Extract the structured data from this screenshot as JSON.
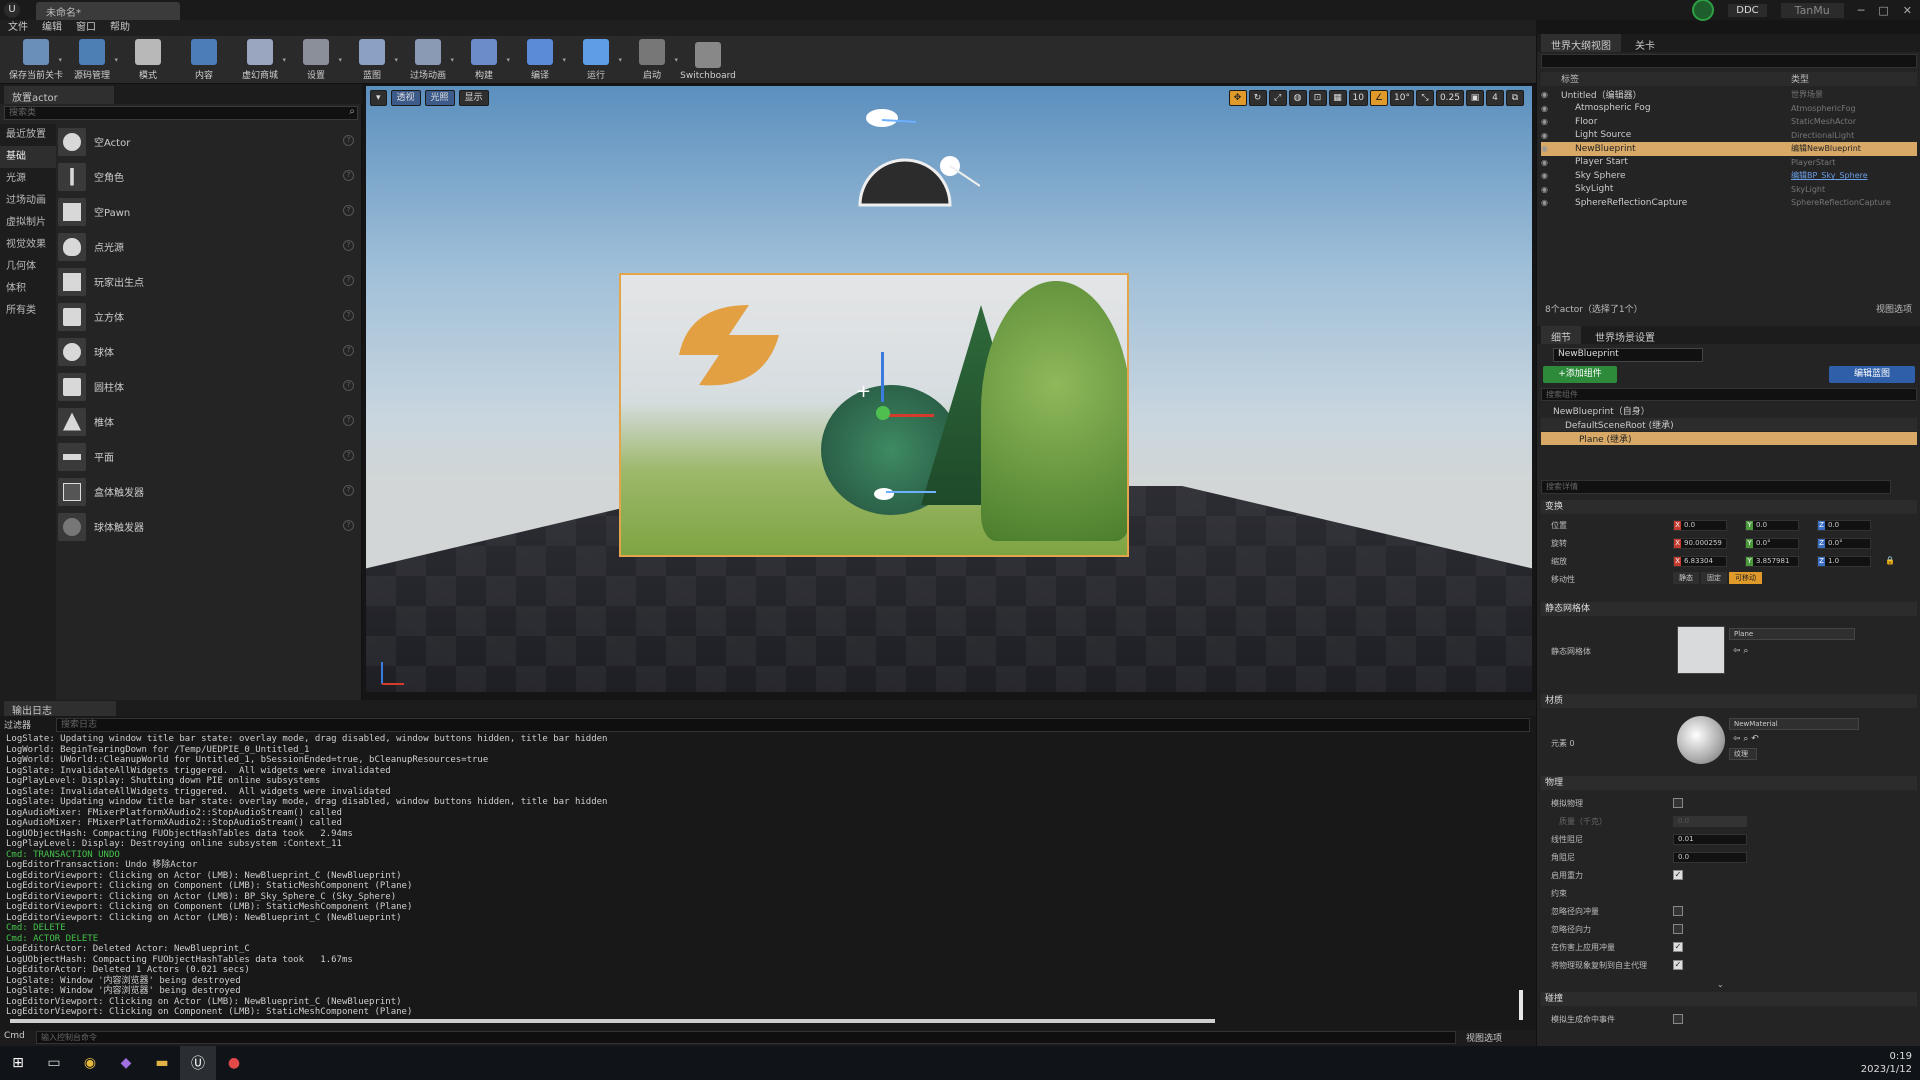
{
  "window": {
    "tab_title": "未命名*",
    "ddc_label": "DDC",
    "user": "TanMu",
    "menu": [
      "文件",
      "编辑",
      "窗口",
      "帮助"
    ]
  },
  "toolbar": [
    {
      "label": "保存当前关卡",
      "icon": "save-icon"
    },
    {
      "label": "源码管理",
      "icon": "source-control-icon"
    },
    {
      "label": "模式",
      "icon": "modes-icon"
    },
    {
      "label": "内容",
      "icon": "content-icon"
    },
    {
      "label": "虚幻商城",
      "icon": "marketplace-icon"
    },
    {
      "label": "设置",
      "icon": "settings-icon"
    },
    {
      "label": "蓝图",
      "icon": "blueprint-icon"
    },
    {
      "label": "过场动画",
      "icon": "cinematics-icon"
    },
    {
      "label": "构建",
      "icon": "build-icon"
    },
    {
      "label": "编译",
      "icon": "compile-icon"
    },
    {
      "label": "运行",
      "icon": "play-icon"
    },
    {
      "label": "启动",
      "icon": "launch-icon"
    },
    {
      "label": "Switchboard",
      "icon": "switchboard-icon"
    }
  ],
  "place_actors": {
    "tab": "放置actor",
    "search_placeholder": "搜索类",
    "categories": [
      "最近放置",
      "基础",
      "光源",
      "过场动画",
      "虚拟制片",
      "视觉效果",
      "几何体",
      "体积",
      "所有类"
    ],
    "active_category": "基础",
    "items": [
      "空Actor",
      "空角色",
      "空Pawn",
      "点光源",
      "玩家出生点",
      "立方体",
      "球体",
      "圆柱体",
      "椎体",
      "平面",
      "盒体触发器",
      "球体触发器"
    ]
  },
  "viewport": {
    "btn_perspective": "透视",
    "btn_lit": "光照",
    "btn_show": "显示",
    "grid_snap": "10",
    "rot_snap": "10°",
    "scale_snap": "0.25",
    "cam_speed": "4"
  },
  "output_log": {
    "tab": "输出日志",
    "filter": "过滤器",
    "search_placeholder": "搜索日志",
    "lines": [
      {
        "t": "LogSlate: Updating window title bar state: overlay mode, drag disabled, window buttons hidden, title bar hidden",
        "c": ""
      },
      {
        "t": "LogWorld: BeginTearingDown for /Temp/UEDPIE_0_Untitled_1",
        "c": ""
      },
      {
        "t": "LogWorld: UWorld::CleanupWorld for Untitled_1, bSessionEnded=true, bCleanupResources=true",
        "c": ""
      },
      {
        "t": "LogSlate: InvalidateAllWidgets triggered.  All widgets were invalidated",
        "c": ""
      },
      {
        "t": "LogPlayLevel: Display: Shutting down PIE online subsystems",
        "c": ""
      },
      {
        "t": "LogSlate: InvalidateAllWidgets triggered.  All widgets were invalidated",
        "c": ""
      },
      {
        "t": "LogSlate: Updating window title bar state: overlay mode, drag disabled, window buttons hidden, title bar hidden",
        "c": ""
      },
      {
        "t": "LogAudioMixer: FMixerPlatformXAudio2::StopAudioStream() called",
        "c": ""
      },
      {
        "t": "LogAudioMixer: FMixerPlatformXAudio2::StopAudioStream() called",
        "c": ""
      },
      {
        "t": "LogUObjectHash: Compacting FUObjectHashTables data took   2.94ms",
        "c": ""
      },
      {
        "t": "LogPlayLevel: Display: Destroying online subsystem :Context_11",
        "c": ""
      },
      {
        "t": "Cmd: TRANSACTION UNDO",
        "c": "green"
      },
      {
        "t": "LogEditorTransaction: Undo 移除Actor",
        "c": ""
      },
      {
        "t": "LogEditorViewport: Clicking on Actor (LMB): NewBlueprint_C (NewBlueprint)",
        "c": ""
      },
      {
        "t": "LogEditorViewport: Clicking on Component (LMB): StaticMeshComponent (Plane)",
        "c": ""
      },
      {
        "t": "LogEditorViewport: Clicking on Actor (LMB): BP_Sky_Sphere_C (Sky_Sphere)",
        "c": ""
      },
      {
        "t": "LogEditorViewport: Clicking on Component (LMB): StaticMeshComponent (Plane)",
        "c": ""
      },
      {
        "t": "LogEditorViewport: Clicking on Actor (LMB): NewBlueprint_C (NewBlueprint)",
        "c": ""
      },
      {
        "t": "Cmd: DELETE",
        "c": "green"
      },
      {
        "t": "Cmd: ACTOR DELETE",
        "c": "green"
      },
      {
        "t": "LogEditorActor: Deleted Actor: NewBlueprint_C",
        "c": ""
      },
      {
        "t": "LogUObjectHash: Compacting FUObjectHashTables data took   1.67ms",
        "c": ""
      },
      {
        "t": "LogEditorActor: Deleted 1 Actors (0.021 secs)",
        "c": ""
      },
      {
        "t": "LogSlate: Window '内容浏览器' being destroyed",
        "c": ""
      },
      {
        "t": "LogSlate: Window '内容浏览器' being destroyed",
        "c": ""
      },
      {
        "t": "LogEditorViewport: Clicking on Actor (LMB): NewBlueprint_C (NewBlueprint)",
        "c": ""
      },
      {
        "t": "LogEditorViewport: Clicking on Component (LMB): StaticMeshComponent (Plane)",
        "c": ""
      }
    ],
    "cmd_label": "Cmd",
    "cmd_placeholder": "输入控制台命令",
    "view_options": "视图选项"
  },
  "outliner": {
    "tab": "世界大纲视图",
    "tab2": "关卡",
    "col_label": "标签",
    "col_type": "类型",
    "rows": [
      {
        "name": "Untitled（编辑器）",
        "type": "世界场景",
        "sel": false,
        "link": false
      },
      {
        "name": "Atmospheric Fog",
        "type": "AtmosphericFog",
        "sel": false,
        "link": false
      },
      {
        "name": "Floor",
        "type": "StaticMeshActor",
        "sel": false,
        "link": false
      },
      {
        "name": "Light Source",
        "type": "DirectionalLight",
        "sel": false,
        "link": false
      },
      {
        "name": "NewBlueprint",
        "type": "编辑NewBlueprint",
        "sel": true,
        "link": false
      },
      {
        "name": "Player Start",
        "type": "PlayerStart",
        "sel": false,
        "link": false
      },
      {
        "name": "Sky Sphere",
        "type": "编辑BP_Sky_Sphere",
        "sel": false,
        "link": true
      },
      {
        "name": "SkyLight",
        "type": "SkyLight",
        "sel": false,
        "link": false
      },
      {
        "name": "SphereReflectionCapture",
        "type": "SphereReflectionCapture",
        "sel": false,
        "link": false
      }
    ],
    "count": "8个actor（选择了1个）",
    "view_options": "视图选项"
  },
  "details": {
    "tab": "细节",
    "tab2": "世界场景设置",
    "name": "NewBlueprint",
    "add_component": "+添加组件",
    "edit_blueprint": "编辑蓝图",
    "comp_search_placeholder": "搜索组件",
    "comp_self": "NewBlueprint（自身）",
    "comp_root": "DefaultSceneRoot (继承)",
    "comp_plane": "Plane (继承)",
    "detail_search_placeholder": "搜索详情",
    "transform": "变换",
    "loc_label": "位置",
    "rot_label": "旋转",
    "scale_label": "缩放",
    "mob_label": "移动性",
    "loc": [
      "0.0",
      "0.0",
      "0.0"
    ],
    "rot": [
      "90.000259",
      "0.0°",
      "0.0°"
    ],
    "scale": [
      "6.83304",
      "3.857981",
      "1.0"
    ],
    "mob": [
      "静态",
      "固定",
      "可移动"
    ],
    "static_mesh_section": "静态网格体",
    "static_mesh_label": "静态网格体",
    "static_mesh_value": "Plane",
    "materials_section": "材质",
    "element0_label": "元素 0",
    "material_value": "NewMaterial",
    "texture_btn": "纹理",
    "physics_section": "物理",
    "sim_physics": "模拟物理",
    "mass_label": "质量（千克）",
    "mass_value": "0.0",
    "lin_damp_label": "线性阻尼",
    "lin_damp_value": "0.01",
    "ang_damp_label": "角阻尼",
    "ang_damp_value": "0.0",
    "gravity_label": "启用重力",
    "constraints_label": "约束",
    "ignore_radial_impulse": "忽略径向冲量",
    "ignore_radial_force": "忽略径向力",
    "apply_impulse_on_damage": "在伤害上应用冲量",
    "replicate_physics": "将物理现象复制到自主代理",
    "collision_section": "碰撞",
    "sim_hit_events": "模拟生成命中事件"
  },
  "taskbar": {
    "time": "0:19",
    "date": "2023/1/12",
    "apps": [
      "windows-icon",
      "task-view-icon",
      "chrome-icon",
      "visual-studio-icon",
      "file-explorer-icon",
      "unreal-icon",
      "record-icon"
    ]
  }
}
